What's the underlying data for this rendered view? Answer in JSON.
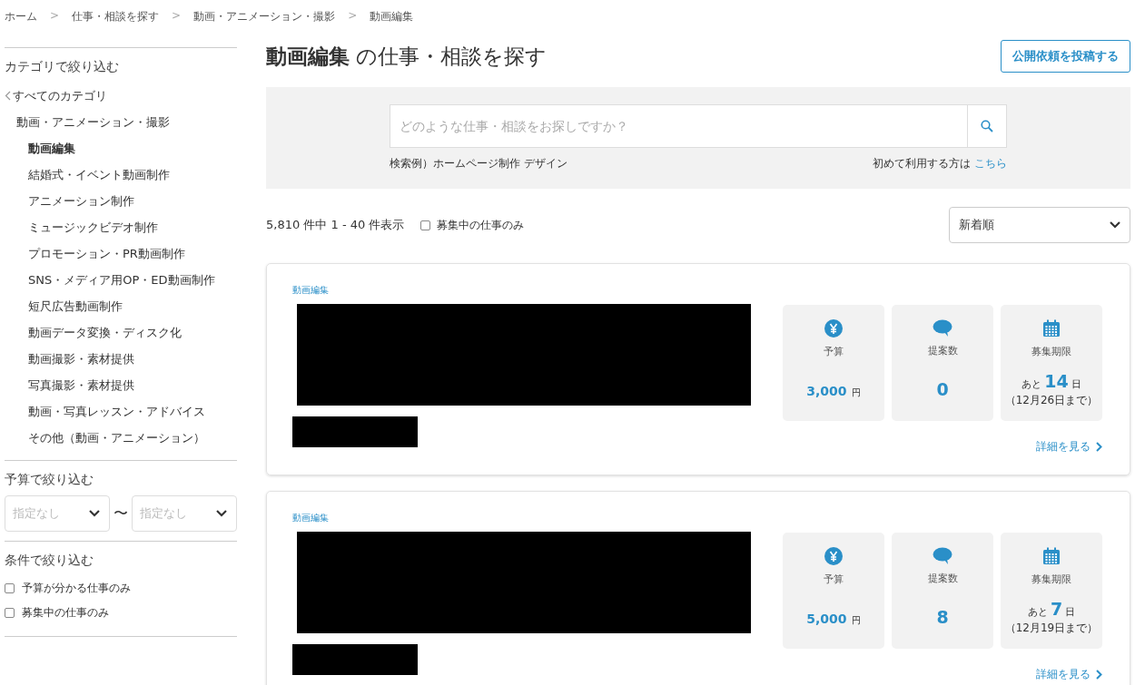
{
  "breadcrumb": [
    "ホーム",
    "仕事・相談を探す",
    "動画・アニメーション・撮影",
    "動画編集"
  ],
  "breadcrumb_separator": ">",
  "sidebar": {
    "category_heading": "カテゴリで絞り込む",
    "all_categories": "すべてのカテゴリ",
    "parent_category": "動画・アニメーション・撮影",
    "categories": [
      {
        "label": "動画編集",
        "selected": true
      },
      {
        "label": "結婚式・イベント動画制作",
        "selected": false
      },
      {
        "label": "アニメーション制作",
        "selected": false
      },
      {
        "label": "ミュージックビデオ制作",
        "selected": false
      },
      {
        "label": "プロモーション・PR動画制作",
        "selected": false
      },
      {
        "label": "SNS・メディア用OP・ED動画制作",
        "selected": false
      },
      {
        "label": "短尺広告動画制作",
        "selected": false
      },
      {
        "label": "動画データ変換・ディスク化",
        "selected": false
      },
      {
        "label": "動画撮影・素材提供",
        "selected": false
      },
      {
        "label": "写真撮影・素材提供",
        "selected": false
      },
      {
        "label": "動画・写真レッスン・アドバイス",
        "selected": false
      },
      {
        "label": "その他（動画・アニメーション）",
        "selected": false
      }
    ],
    "budget_heading": "予算で絞り込む",
    "budget_min": {
      "placeholder": "指定なし"
    },
    "budget_separator": "〜",
    "budget_max": {
      "placeholder": "指定なし"
    },
    "conditions_heading": "条件で絞り込む",
    "conditions": [
      {
        "label": "予算が分かる仕事のみ",
        "checked": false
      },
      {
        "label": "募集中の仕事のみ",
        "checked": false
      }
    ]
  },
  "title_bold": "動画編集",
  "title_rest": "の仕事・相談を探す",
  "post_button": "公開依頼を投稿する",
  "search": {
    "placeholder": "どのような仕事・相談をお探しですか？",
    "example": "検索例）ホームページ制作 デザイン",
    "first_time": "初めて利用する方は",
    "first_time_link": "こちら"
  },
  "result_count": "5,810 件中 1 - 40 件表示",
  "open_only": {
    "label": "募集中の仕事のみ",
    "checked": false
  },
  "sort": "新着順",
  "jobs": [
    {
      "category": "動画編集",
      "budget_label": "予算",
      "budget": "3,000",
      "budget_unit": "円",
      "proposals_label": "提案数",
      "proposals": "0",
      "deadline_label": "募集期限",
      "deadline_prefix": "あと",
      "deadline_days": "14",
      "deadline_unit": "日",
      "deadline_date": "（12月26日まで）",
      "details": "詳細を見る"
    },
    {
      "category": "動画編集",
      "budget_label": "予算",
      "budget": "5,000",
      "budget_unit": "円",
      "proposals_label": "提案数",
      "proposals": "8",
      "deadline_label": "募集期限",
      "deadline_prefix": "あと",
      "deadline_days": "7",
      "deadline_unit": "日",
      "deadline_date": "（12月19日まで）",
      "details": "詳細を見る"
    }
  ]
}
